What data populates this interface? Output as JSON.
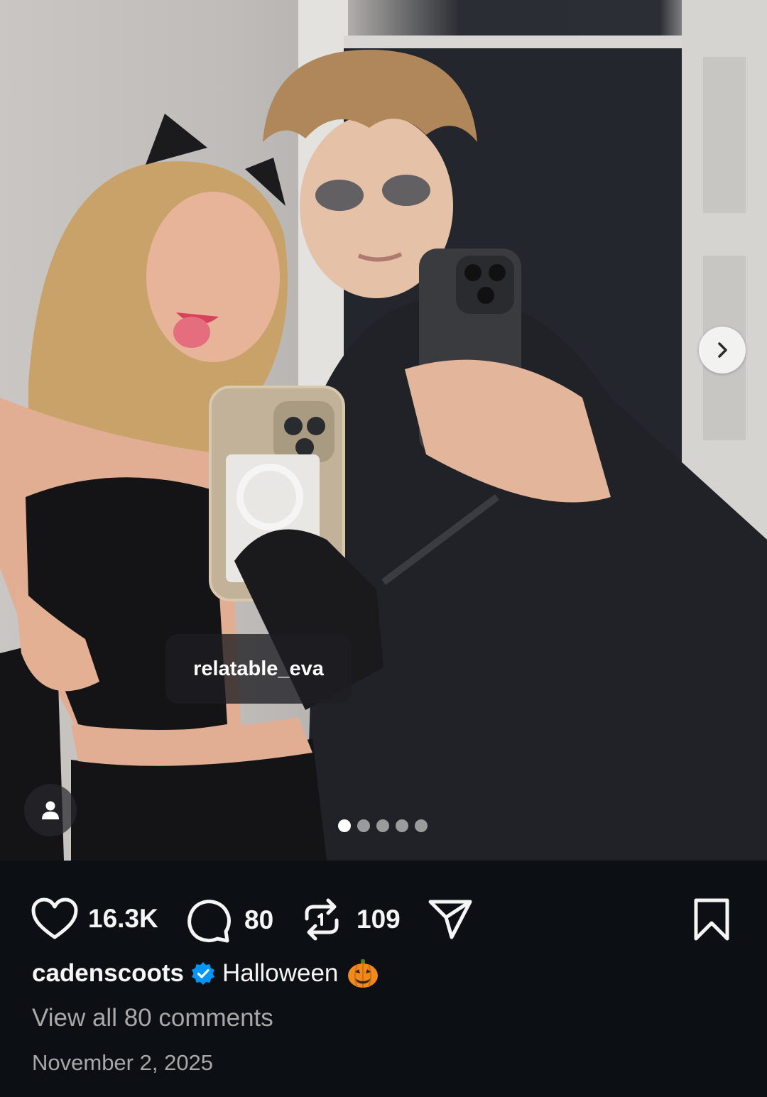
{
  "post": {
    "media": {
      "description_icon": "photo",
      "tagged_user": "relatable_eva",
      "carousel_total": 5,
      "carousel_current": 1
    },
    "actions": {
      "likes": "16.3K",
      "comments": "80",
      "reposts": "109"
    },
    "caption": {
      "username": "cadenscoots",
      "verified": true,
      "text": "Halloween",
      "emoji_icon": "pumpkin-icon"
    },
    "view_comments": "View all 80 comments",
    "date": "November 2, 2025"
  },
  "colors": {
    "background": "#0c1014",
    "text_primary": "#f5f5f5",
    "text_secondary": "#a8a8a8",
    "verified_blue": "#0095f6"
  }
}
